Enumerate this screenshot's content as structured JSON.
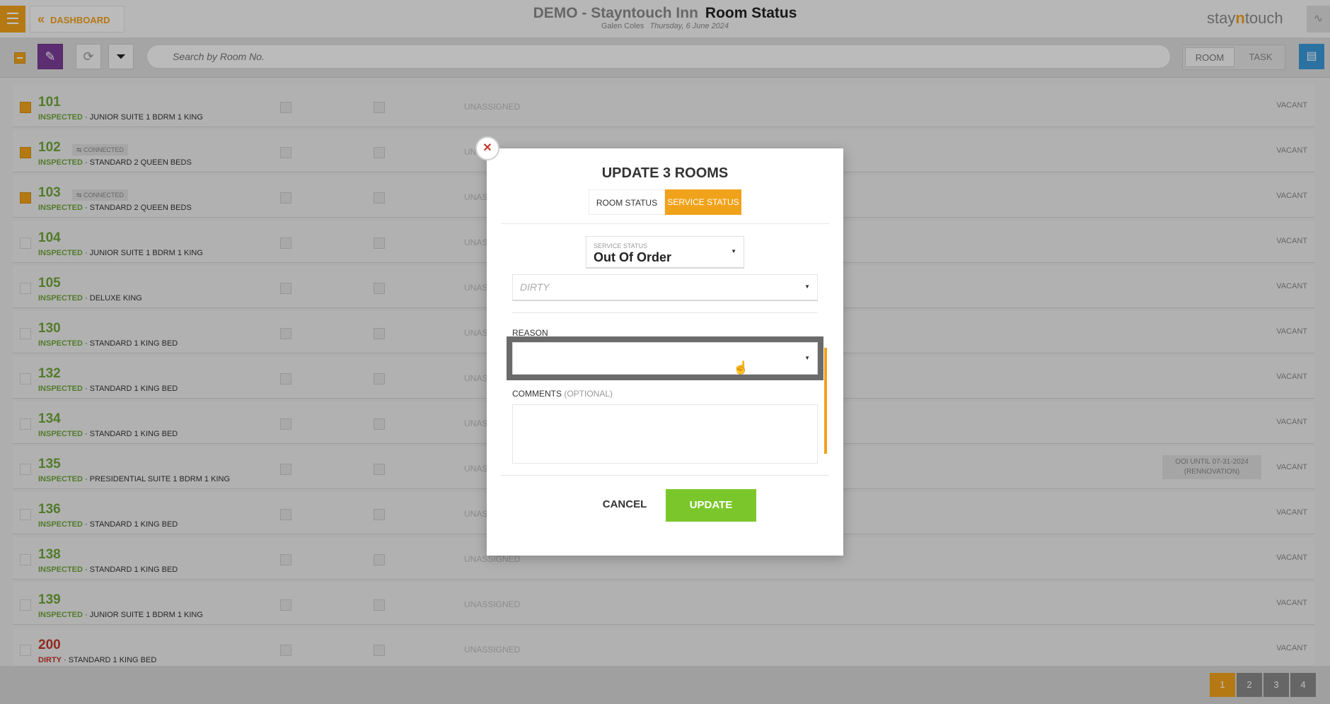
{
  "header": {
    "menu_icon": "hamburger-icon",
    "dashboard_label": "DASHBOARD",
    "hotel_name": "DEMO - Stayntouch Inn",
    "page_title": "Room Status",
    "user_name": "Galen Coles",
    "date": "Thursday, 6 June 2024",
    "logo_text_a": "stay",
    "logo_text_b": "n",
    "logo_text_c": "touch"
  },
  "toolbar": {
    "search_placeholder": "Search by Room No.",
    "tab_room": "ROOM",
    "tab_task": "TASK"
  },
  "rooms": [
    {
      "number": "101",
      "connected": "",
      "status": "INSPECTED",
      "type": "JUNIOR SUITE 1 BDRM 1 KING",
      "assign": "UNASSIGNED",
      "occupancy": "VACANT",
      "ooi": "",
      "selected": true
    },
    {
      "number": "102",
      "connected": "CONNECTED",
      "status": "INSPECTED",
      "type": "STANDARD 2 QUEEN BEDS",
      "assign": "UN",
      "occupancy": "VACANT",
      "ooi": "",
      "selected": true
    },
    {
      "number": "103",
      "connected": "CONNECTED",
      "status": "INSPECTED",
      "type": "STANDARD 2 QUEEN BEDS",
      "assign": "UNAS",
      "occupancy": "VACANT",
      "ooi": "",
      "selected": true
    },
    {
      "number": "104",
      "connected": "",
      "status": "INSPECTED",
      "type": "JUNIOR SUITE 1 BDRM 1 KING",
      "assign": "UNAS",
      "occupancy": "VACANT",
      "ooi": "",
      "selected": false
    },
    {
      "number": "105",
      "connected": "",
      "status": "INSPECTED",
      "type": "DELUXE KING",
      "assign": "UNAS",
      "occupancy": "VACANT",
      "ooi": "",
      "selected": false
    },
    {
      "number": "130",
      "connected": "",
      "status": "INSPECTED",
      "type": "STANDARD 1 KING BED",
      "assign": "UNAS",
      "occupancy": "VACANT",
      "ooi": "",
      "selected": false
    },
    {
      "number": "132",
      "connected": "",
      "status": "INSPECTED",
      "type": "STANDARD 1 KING BED",
      "assign": "UNAS",
      "occupancy": "VACANT",
      "ooi": "",
      "selected": false
    },
    {
      "number": "134",
      "connected": "",
      "status": "INSPECTED",
      "type": "STANDARD 1 KING BED",
      "assign": "UNAS",
      "occupancy": "VACANT",
      "ooi": "",
      "selected": false
    },
    {
      "number": "135",
      "connected": "",
      "status": "INSPECTED",
      "type": "PRESIDENTIAL SUITE 1 BDRM 1 KING",
      "assign": "UNAS",
      "occupancy": "VACANT",
      "ooi": "OOI UNTIL 07-31-2024 (RENNOVATION)",
      "selected": false
    },
    {
      "number": "136",
      "connected": "",
      "status": "INSPECTED",
      "type": "STANDARD 1 KING BED",
      "assign": "UNAS",
      "occupancy": "VACANT",
      "ooi": "",
      "selected": false
    },
    {
      "number": "138",
      "connected": "",
      "status": "INSPECTED",
      "type": "STANDARD 1 KING BED",
      "assign": "UNASSIGNED",
      "occupancy": "VACANT",
      "ooi": "",
      "selected": false
    },
    {
      "number": "139",
      "connected": "",
      "status": "INSPECTED",
      "type": "JUNIOR SUITE 1 BDRM 1 KING",
      "assign": "UNASSIGNED",
      "occupancy": "VACANT",
      "ooi": "",
      "selected": false
    },
    {
      "number": "200",
      "connected": "",
      "status": "DIRTY",
      "type": "STANDARD 1 KING BED",
      "assign": "UNASSIGNED",
      "occupancy": "VACANT",
      "ooi": "",
      "selected": false
    }
  ],
  "pagination": [
    "1",
    "2",
    "3",
    "4"
  ],
  "modal": {
    "title": "UPDATE 3 ROOMS",
    "tab_room_status": "ROOM STATUS",
    "tab_service_status": "SERVICE STATUS",
    "service_status_label": "SERVICE STATUS",
    "service_status_value": "Out Of Order",
    "room_status_placeholder": "DIRTY",
    "reason_label": "REASON",
    "reason_value": "",
    "comments_label": "COMMENTS",
    "comments_optional": "(OPTIONAL)",
    "cancel_label": "CANCEL",
    "update_label": "UPDATE",
    "close_symbol": "✕"
  },
  "colors": {
    "accent": "#f0a21a",
    "inspected": "#6ea43a",
    "dirty": "#c0392b",
    "update_button": "#7bc72b",
    "edit_button": "#7d3c98"
  }
}
